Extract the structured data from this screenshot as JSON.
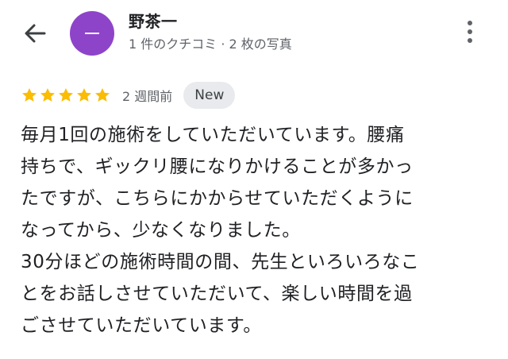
{
  "reviewer": {
    "name": "野茶一",
    "meta": "1 件のクチコミ · 2 枚の写真",
    "avatar_color": "#8e44c9"
  },
  "review": {
    "rating": 5,
    "star_color": "#fbbc04",
    "time": "2 週間前",
    "badge": "New",
    "lines": [
      "毎月1回の施術をしていただいています。腰痛",
      "持ちで、ギックリ腰になりかけることが多かっ",
      "たですが、こちらにかからせていただくように",
      "なってから、少なくなりました。",
      "30分ほどの施術時間の間、先生といろいろなこ",
      "とをお話しさせていただいて、楽しい時間を過",
      "ごさせていただいています。"
    ]
  },
  "icons": {
    "back": "arrow-back-icon",
    "more": "more-vert-icon",
    "star": "star-icon"
  }
}
